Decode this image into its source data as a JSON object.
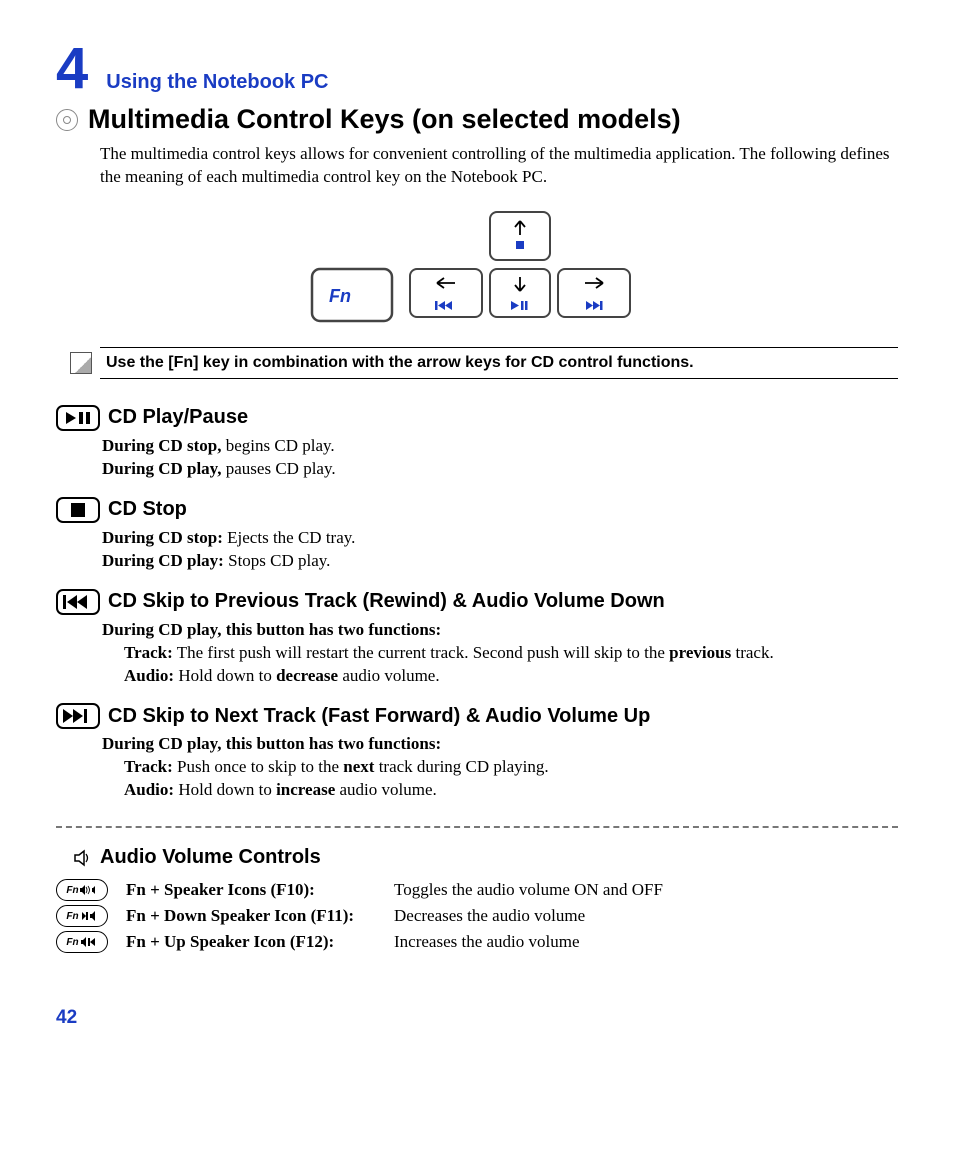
{
  "chapter": {
    "number": "4",
    "title": "Using the Notebook PC"
  },
  "heading": "Multimedia Control Keys (on selected models)",
  "intro": "The multimedia control keys allows for convenient controlling of the multimedia application. The following defines the meaning of each multimedia control key on the Notebook PC.",
  "fn_label": "Fn",
  "note": "Use the [Fn] key in combination with the arrow keys for CD control functions.",
  "sections": {
    "play": {
      "title": "CD Play/Pause",
      "l1a": "During CD stop,",
      "l1b": " begins CD play.",
      "l2a": "During CD play,",
      "l2b": " pauses CD play."
    },
    "stop": {
      "title": "CD Stop",
      "l1a": "During CD stop:",
      "l1b": " Ejects the CD tray.",
      "l2a": "During CD play:",
      "l2b": " Stops CD play."
    },
    "prev": {
      "title": "CD Skip to Previous Track (Rewind) & Audio Volume Down",
      "intro": "During CD play, this button has two functions:",
      "t1a": "Track:",
      "t1b": " The first push will restart the current track. Second push will skip to the ",
      "t1c": "previous",
      "t1d": " track.",
      "a1a": "Audio:",
      "a1b": " Hold down to ",
      "a1c": "decrease",
      "a1d": " audio volume."
    },
    "next": {
      "title": "CD Skip to Next Track (Fast Forward) & Audio Volume Up",
      "intro": "During CD play, this button has two functions:",
      "t1a": "Track:",
      "t1b": " Push once to skip to the ",
      "t1c": "next",
      "t1d": " track during CD playing.",
      "a1a": "Audio:",
      "a1b": " Hold down to ",
      "a1c": "increase",
      "a1d": " audio volume."
    }
  },
  "audio": {
    "title": "Audio Volume Controls",
    "rows": [
      {
        "label": "Fn + Speaker Icons (F10):",
        "desc": "Toggles the audio volume ON and OFF"
      },
      {
        "label": "Fn + Down Speaker Icon (F11):",
        "desc": "Decreases the audio volume"
      },
      {
        "label": "Fn + Up Speaker Icon (F12):",
        "desc": "Increases the audio volume"
      }
    ]
  },
  "page": "42"
}
